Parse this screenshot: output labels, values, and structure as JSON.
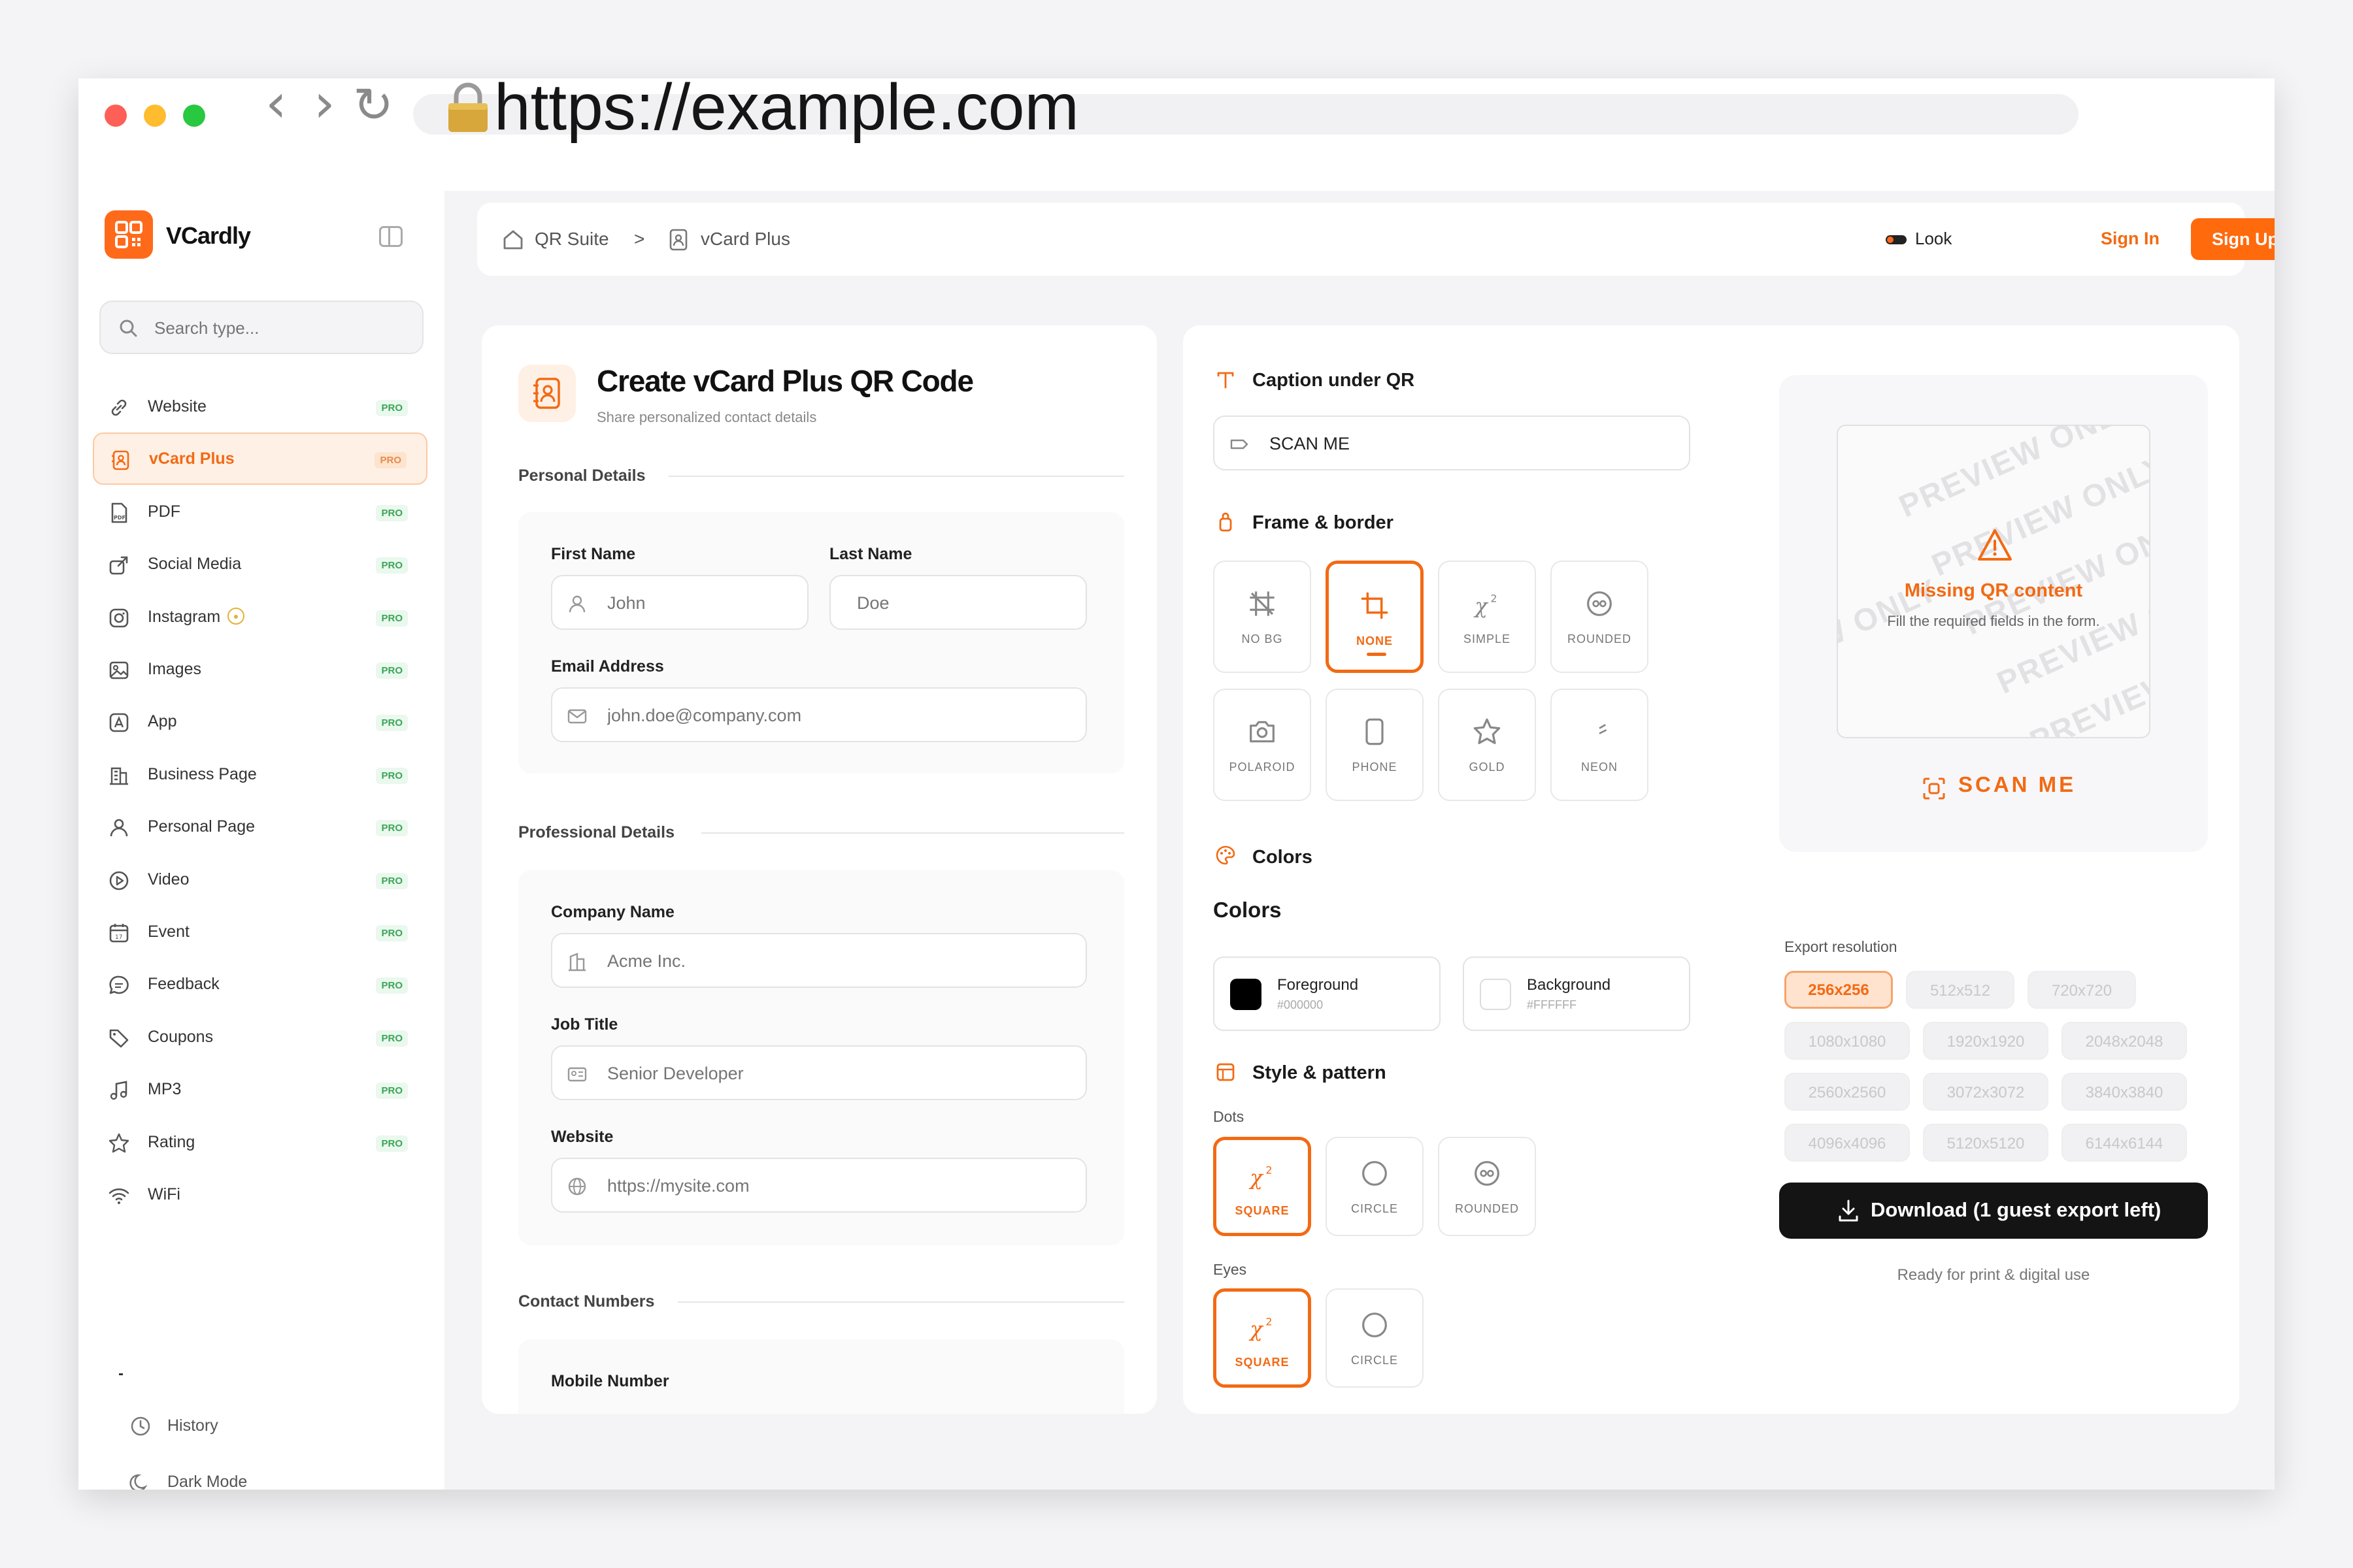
{
  "browser": {
    "url": "https://example.com"
  },
  "sidebar": {
    "brand": "VCardly",
    "search_placeholder": "Search type...",
    "items": [
      {
        "label": "Website",
        "badge": "PRO",
        "icon": "link-icon"
      },
      {
        "label": "vCard Plus",
        "badge": "PRO",
        "icon": "contact-card-icon",
        "active": true
      },
      {
        "label": "PDF",
        "badge": "PRO",
        "icon": "pdf-icon"
      },
      {
        "label": "Social Media",
        "badge": "PRO",
        "icon": "share-icon"
      },
      {
        "label": "Instagram",
        "badge": "PRO",
        "icon": "instagram-icon"
      },
      {
        "label": "Images",
        "badge": "PRO",
        "icon": "image-icon"
      },
      {
        "label": "App",
        "badge": "PRO",
        "icon": "app-icon"
      },
      {
        "label": "Business Page",
        "badge": "PRO",
        "icon": "building-icon"
      },
      {
        "label": "Personal Page",
        "badge": "PRO",
        "icon": "user-icon"
      },
      {
        "label": "Video",
        "badge": "PRO",
        "icon": "play-icon"
      },
      {
        "label": "Event",
        "badge": "PRO",
        "icon": "calendar-icon"
      },
      {
        "label": "Feedback",
        "badge": "PRO",
        "icon": "chat-icon"
      },
      {
        "label": "Coupons",
        "badge": "PRO",
        "icon": "tag-icon"
      },
      {
        "label": "MP3",
        "badge": "PRO",
        "icon": "music-icon"
      },
      {
        "label": "Rating",
        "badge": "PRO",
        "icon": "star-icon"
      },
      {
        "label": "WiFi",
        "badge": "",
        "icon": "wifi-icon"
      }
    ],
    "bottom": {
      "history": "History",
      "dark_mode": "Dark Mode"
    }
  },
  "topbar": {
    "breadcrumb": [
      "QR Suite",
      ">",
      "vCard Plus"
    ],
    "look": "Look",
    "sign_in": "Sign In",
    "sign_up": "Sign Up"
  },
  "form": {
    "title": "Create vCard Plus QR Code",
    "subtitle": "Share personalized contact details",
    "personal": {
      "title": "Personal Details",
      "first_name_label": "First Name",
      "first_name_placeholder": "John",
      "last_name_label": "Last Name",
      "last_name_placeholder": "Doe",
      "email_label": "Email Address",
      "email_placeholder": "john.doe@company.com"
    },
    "professional": {
      "title": "Professional Details",
      "company_label": "Company Name",
      "company_placeholder": "Acme Inc.",
      "job_label": "Job Title",
      "job_placeholder": "Senior Developer",
      "website_label": "Website",
      "website_placeholder": "https://mysite.com"
    },
    "contact": {
      "title": "Contact Numbers",
      "mobile_label": "Mobile Number"
    }
  },
  "design": {
    "caption_title": "Caption under QR",
    "caption_value": "SCAN ME",
    "frame_title": "Frame & border",
    "frames": [
      {
        "label": "NO BG",
        "icon": "no-bg-icon"
      },
      {
        "label": "NONE",
        "icon": "crop-icon",
        "selected": true
      },
      {
        "label": "SIMPLE",
        "icon": "simple-icon"
      },
      {
        "label": "ROUNDED",
        "icon": "rounded-icon"
      },
      {
        "label": "POLAROID",
        "icon": "camera-icon"
      },
      {
        "label": "PHONE",
        "icon": "phone-icon"
      },
      {
        "label": "GOLD",
        "icon": "star-icon"
      },
      {
        "label": "NEON",
        "icon": "leaf-icon"
      }
    ],
    "colors_title": "Colors",
    "colors_subtitle": "Colors",
    "foreground": {
      "label": "Foreground",
      "hex": "#000000"
    },
    "background": {
      "label": "Background",
      "hex": "#FFFFFF"
    },
    "style_title": "Style & pattern",
    "dots_label": "Dots",
    "dots": [
      {
        "label": "SQUARE",
        "selected": true
      },
      {
        "label": "CIRCLE"
      },
      {
        "label": "ROUNDED"
      }
    ],
    "eyes_label": "Eyes",
    "eyes": [
      {
        "label": "SQUARE",
        "selected": true
      },
      {
        "label": "CIRCLE"
      }
    ]
  },
  "preview": {
    "watermark": "PREVIEW ONLY",
    "missing_title": "Missing QR content",
    "missing_desc": "Fill the required fields in the form.",
    "caption": "SCAN ME",
    "export_label": "Export resolution",
    "resolutions": [
      "256x256",
      "512x512",
      "720x720",
      "1080x1080",
      "1920x1920",
      "2048x2048",
      "2560x2560",
      "3072x3072",
      "3840x3840",
      "4096x4096",
      "5120x5120",
      "6144x6144"
    ],
    "selected_resolution": "256x256",
    "download": "Download (1 guest export left)",
    "footnote": "Ready for print & digital use"
  },
  "colors": {
    "accent": "#FF6A1A",
    "dark": "#141414",
    "pro_green": "#3AA655"
  }
}
